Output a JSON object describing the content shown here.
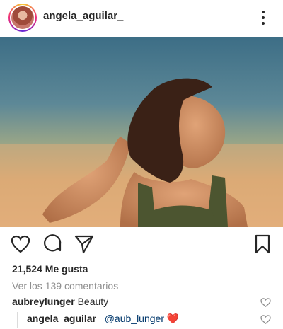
{
  "post": {
    "username": "angela_aguilar_",
    "likes_text": "21,524 Me gusta",
    "view_comments_text": "Ver los 139 comentarios"
  },
  "comments": [
    {
      "user": "aubreylunger",
      "text": "Beauty",
      "mention": "",
      "emoji": ""
    },
    {
      "user": "angela_aguilar_",
      "text": "",
      "mention": "@aub_lunger",
      "emoji": "❤️"
    }
  ],
  "icons": {
    "more": "more-options-icon",
    "like": "heart-icon",
    "comment": "comment-bubble-icon",
    "share": "paper-plane-icon",
    "save": "bookmark-icon"
  },
  "colors": {
    "text": "#262626",
    "muted": "#8e8e8e",
    "mention": "#00376b",
    "heart_emoji": "#e0245e"
  }
}
